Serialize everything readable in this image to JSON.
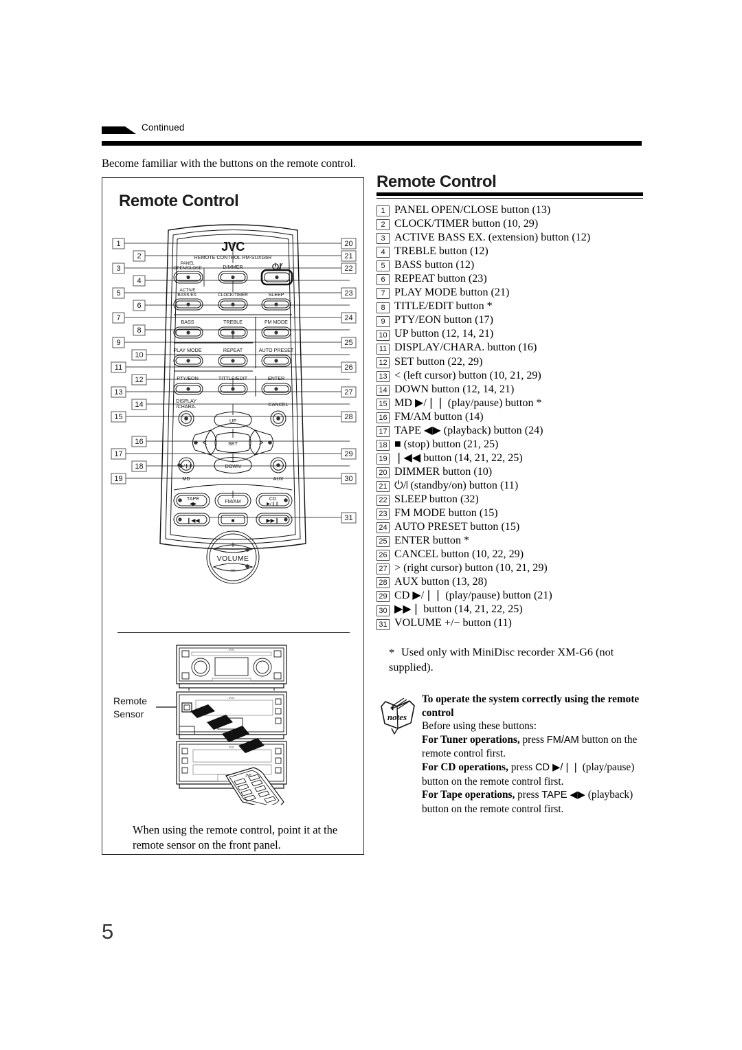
{
  "running_head": {
    "arrow_icon": "continued-arrow-icon",
    "label": "Continued"
  },
  "intro": {
    "text": "Become familiar with the buttons on the remote control."
  },
  "left_panel": {
    "title": "Remote Control",
    "remote": {
      "brand": "JVC",
      "model_line": "REMOTE CONTROL RM-SUXG6R",
      "buttons": [
        "PANEL OPEN/CLOSE",
        "DIMMER",
        "standby-on",
        "ACTIVE BASS EX.",
        "CLOCK/TIMER",
        "SLEEP",
        "BASS",
        "TREBLE",
        "FM MODE",
        "PLAY MODE",
        "REPEAT",
        "AUTO PRESET",
        "PTY/EON",
        "TITTLE/EDIT",
        "ENTER",
        "DISPLAY /CHARA.",
        "UP",
        "CANCEL",
        "<",
        "SET",
        ">",
        "MD",
        "DOWN",
        "AUX",
        "TAPE",
        "FM/AM",
        "CD",
        "VOLUME"
      ],
      "labels": {
        "panel_open_close_1": "PANEL",
        "panel_open_close_2": "OPEN/CLOSE",
        "dimmer": "DIMMER",
        "active_1": "ACTIVE",
        "active_2": "BASS EX.",
        "clock_timer": "CLOCK/TIMER",
        "sleep": "SLEEP",
        "bass": "BASS",
        "treble": "TREBLE",
        "fm_mode": "FM MODE",
        "play_mode": "PLAY MODE",
        "repeat": "REPEAT",
        "auto_preset": "AUTO PRESET",
        "pty_eon": "PTY/EON",
        "title_edit": "TITTLE/EDIT",
        "enter": "ENTER",
        "display_1": "DISPLAY",
        "display_2": "/CHARA.",
        "up": "UP",
        "cancel": "CANCEL",
        "left_cursor": "<",
        "set": "SET",
        "right_cursor": ">",
        "md": "MD",
        "down": "DOWN",
        "aux": "AUX",
        "tape": "TAPE",
        "fm_am": "FM/AM",
        "cd": "CD",
        "volume": "VOLUME",
        "volume_plus": "+",
        "volume_minus": "−"
      },
      "callouts_left": [
        "1",
        "2",
        "3",
        "4",
        "5",
        "6",
        "7",
        "8",
        "9",
        "10",
        "11",
        "12",
        "13",
        "14",
        "15",
        "16",
        "17",
        "18",
        "19"
      ],
      "callouts_right": [
        "20",
        "21",
        "22",
        "23",
        "24",
        "25",
        "26",
        "27",
        "28",
        "29",
        "30",
        "31"
      ]
    },
    "sensor_label_line1": "Remote",
    "sensor_label_line2": "Sensor",
    "caption": "When using the remote control, point it at the remote sensor on the front panel."
  },
  "right_column": {
    "title": "Remote Control",
    "items": [
      {
        "num": "1",
        "text": "PANEL OPEN/CLOSE button (13)"
      },
      {
        "num": "2",
        "text": "CLOCK/TIMER button (10, 29)"
      },
      {
        "num": "3",
        "text": "ACTIVE BASS EX. (extension) button (12)"
      },
      {
        "num": "4",
        "text": "TREBLE button (12)"
      },
      {
        "num": "5",
        "text": "BASS button (12)"
      },
      {
        "num": "6",
        "text": "REPEAT button (23)"
      },
      {
        "num": "7",
        "text": "PLAY MODE button (21)"
      },
      {
        "num": "8",
        "text": "TITLE/EDIT button *"
      },
      {
        "num": "9",
        "text": "PTY/EON button (17)"
      },
      {
        "num": "10",
        "text": "UP button (12, 14, 21)"
      },
      {
        "num": "11",
        "text": "DISPLAY/CHARA. button (16)"
      },
      {
        "num": "12",
        "text": "SET button (22, 29)"
      },
      {
        "num": "13",
        "text": "< (left cursor) button (10, 21, 29)"
      },
      {
        "num": "14",
        "text": "DOWN button (12, 14, 21)"
      },
      {
        "num": "15",
        "text": "MD ▶/❘❘ (play/pause) button *"
      },
      {
        "num": "16",
        "text": "FM/AM button (14)"
      },
      {
        "num": "17",
        "text": "TAPE ◀▶ (playback) button (24)"
      },
      {
        "num": "18",
        "text": "■ (stop) button (21, 25)"
      },
      {
        "num": "19",
        "text": "❘◀◀ button (14, 21, 22, 25)"
      },
      {
        "num": "20",
        "text": "DIMMER button (10)"
      },
      {
        "num": "21",
        "text": "⏻/❘ (standby/on) button (11)"
      },
      {
        "num": "22",
        "text": "SLEEP button (32)"
      },
      {
        "num": "23",
        "text": "FM MODE button (15)"
      },
      {
        "num": "24",
        "text": "AUTO PRESET button (15)"
      },
      {
        "num": "25",
        "text": "ENTER button *"
      },
      {
        "num": "26",
        "text": "CANCEL button (10, 22, 29)"
      },
      {
        "num": "27",
        "text": "> (right cursor) button (10, 21, 29)"
      },
      {
        "num": "28",
        "text": "AUX button (13, 28)"
      },
      {
        "num": "29",
        "text": "CD ▶/❘❘ (play/pause) button (21)"
      },
      {
        "num": "30",
        "text": "▶▶❘ button (14, 21, 22, 25)"
      },
      {
        "num": "31",
        "text": "VOLUME +/− button (11)"
      }
    ],
    "footnote": "Used only with MiniDisc recorder XM-G6 (not supplied).",
    "footnote_marker": "*"
  },
  "notes": {
    "icon": "notes-book-icon",
    "icon_label": "notes",
    "heading": "To operate the system correctly using the remote control",
    "intro": "Before using these buttons:",
    "tuner_bold": "For Tuner operations,",
    "tuner_rest_a": " press ",
    "tuner_key": "FM/AM",
    "tuner_rest_b": " button on the remote control first.",
    "cd_bold": "For CD operations,",
    "cd_rest_a": " press ",
    "cd_key": "CD ▶/❘❘",
    "cd_rest_b": " (play/pause) button on the remote control first.",
    "tape_bold": "For Tape operations,",
    "tape_rest_a": " press ",
    "tape_key": "TAPE ◀▶",
    "tape_rest_b": " (playback) button on the remote control first."
  },
  "page_number": "5"
}
